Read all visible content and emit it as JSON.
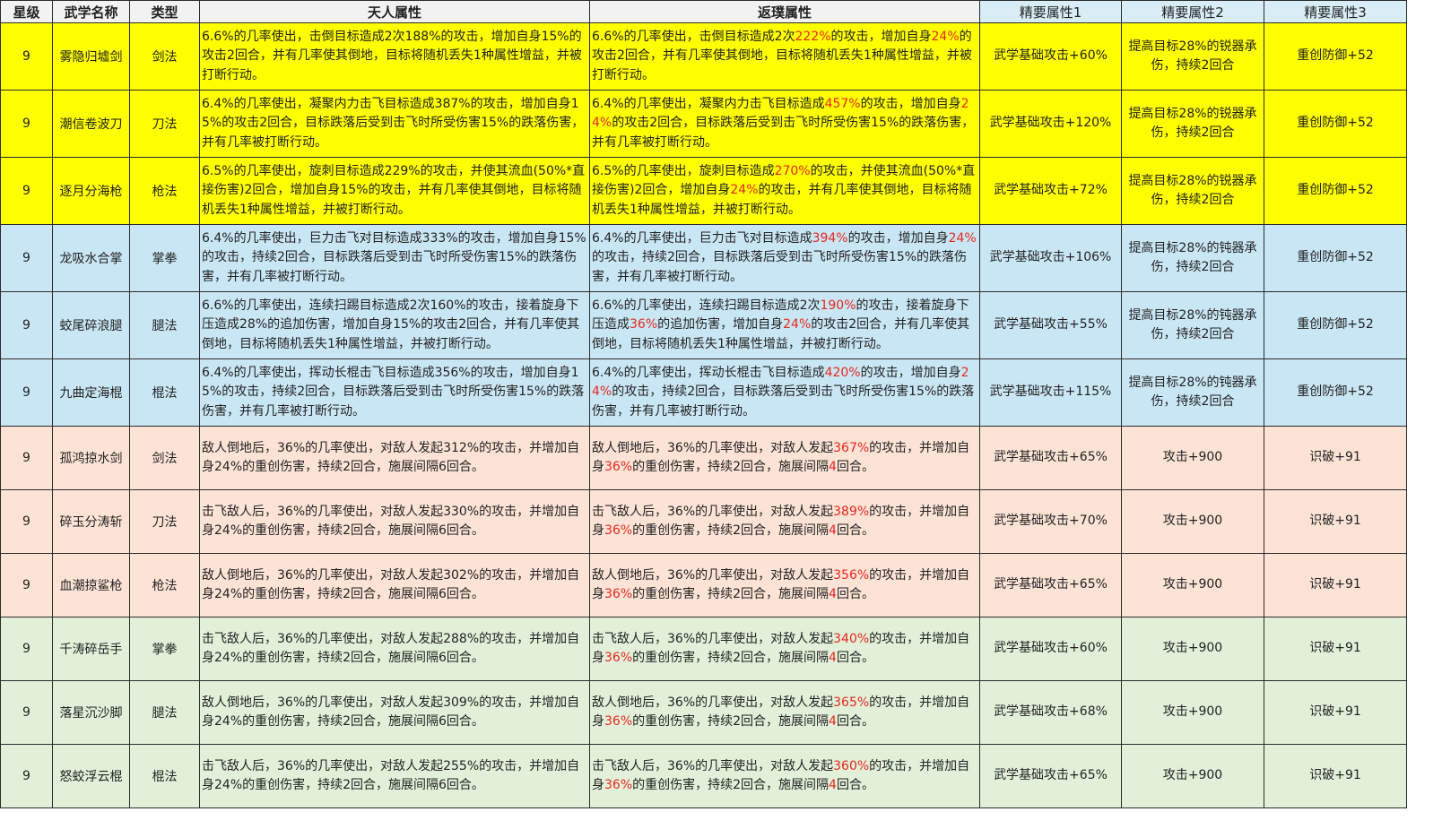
{
  "headers": {
    "star": "星级",
    "name": "武学名称",
    "type": "类型",
    "tianren": "天人属性",
    "fanpu": "返璞属性",
    "jy1": "精要属性1",
    "jy2": "精要属性2",
    "jy3": "精要属性3"
  },
  "colors": {
    "yellow": "#ffff00",
    "blue": "#c9e6f4",
    "peach": "#fce3d6",
    "green": "#e2f0d9",
    "highlight_red": "#e6281e"
  },
  "rows": [
    {
      "group": "y",
      "star": "9",
      "name": "雾隐归墟剑",
      "type": "剑法",
      "tianren": "6.6%的几率使出，击倒目标造成2次188%的攻击，增加自身15%的攻击2回合，并有几率使其倒地，目标将随机丢失1种属性增益，并被打断行动。",
      "fanpu": [
        {
          "t": "6.6%的几率使出，击倒目标造成2次"
        },
        {
          "t": "222%",
          "r": true
        },
        {
          "t": "的攻击，增加自身"
        },
        {
          "t": "24%",
          "r": true
        },
        {
          "t": "的攻击2回合，并有几率使其倒地，目标将随机丢失1种属性增益，并被打断行动。"
        }
      ],
      "jy1": "武学基础攻击+60%",
      "jy2": "提高目标28%的锐器承伤，持续2回合",
      "jy3": "重创防御+52"
    },
    {
      "group": "y",
      "star": "9",
      "name": "潮信卷波刀",
      "type": "刀法",
      "tianren": "6.4%的几率使出，凝聚内力击飞目标造成387%的攻击，增加自身15%的攻击2回合，目标跌落后受到击飞时所受伤害15%的跌落伤害，并有几率被打断行动。",
      "fanpu": [
        {
          "t": "6.4%的几率使出，凝聚内力击飞目标造成"
        },
        {
          "t": "457%",
          "r": true
        },
        {
          "t": "的攻击，增加自身"
        },
        {
          "t": "24%",
          "r": true
        },
        {
          "t": "的攻击2回合，目标跌落后受到击飞时所受伤害15%的跌落伤害，并有几率被打断行动。"
        }
      ],
      "jy1": "武学基础攻击+120%",
      "jy2": "提高目标28%的锐器承伤，持续2回合",
      "jy3": "重创防御+52"
    },
    {
      "group": "y",
      "star": "9",
      "name": "逐月分海枪",
      "type": "枪法",
      "tianren": "6.5%的几率使出，旋刺目标造成229%的攻击，并使其流血(50%*直接伤害)2回合，增加自身15%的攻击，并有几率使其倒地，目标将随机丢失1种属性增益，并被打断行动。",
      "fanpu": [
        {
          "t": "6.5%的几率使出，旋刺目标造成"
        },
        {
          "t": "270%",
          "r": true
        },
        {
          "t": "的攻击，并使其流血(50%*直接伤害)2回合，增加自身"
        },
        {
          "t": "24%",
          "r": true
        },
        {
          "t": "的攻击，并有几率使其倒地，目标将随机丢失1种属性增益，并被打断行动。"
        }
      ],
      "jy1": "武学基础攻击+72%",
      "jy2": "提高目标28%的锐器承伤，持续2回合",
      "jy3": "重创防御+52"
    },
    {
      "group": "b",
      "star": "9",
      "name": "龙吸水合掌",
      "type": "掌拳",
      "tianren": "6.4%的几率使出，巨力击飞对目标造成333%的攻击，增加自身15%的攻击，持续2回合，目标跌落后受到击飞时所受伤害15%的跌落伤害，并有几率被打断行动。",
      "fanpu": [
        {
          "t": "6.4%的几率使出，巨力击飞对目标造成"
        },
        {
          "t": "394%",
          "r": true
        },
        {
          "t": "的攻击，增加自身"
        },
        {
          "t": "24%",
          "r": true
        },
        {
          "t": "的攻击，持续2回合，目标跌落后受到击飞时所受伤害15%的跌落伤害，并有几率被打断行动。"
        }
      ],
      "jy1": "武学基础攻击+106%",
      "jy2": "提高目标28%的钝器承伤，持续2回合",
      "jy3": "重创防御+52"
    },
    {
      "group": "b",
      "star": "9",
      "name": "蛟尾碎浪腿",
      "type": "腿法",
      "tianren": "6.6%的几率使出，连续扫踢目标造成2次160%的攻击，接着旋身下压造成28%的追加伤害，增加自身15%的攻击2回合，并有几率使其倒地，目标将随机丢失1种属性增益，并被打断行动。",
      "fanpu": [
        {
          "t": "6.6%的几率使出，连续扫踢目标造成2次"
        },
        {
          "t": "190%",
          "r": true
        },
        {
          "t": "的攻击，接着旋身下压造成"
        },
        {
          "t": "36%",
          "r": true
        },
        {
          "t": "的追加伤害，增加自身"
        },
        {
          "t": "24%",
          "r": true
        },
        {
          "t": "的攻击2回合，并有几率使其倒地，目标将随机丢失1种属性增益，并被打断行动。"
        }
      ],
      "jy1": "武学基础攻击+55%",
      "jy2": "提高目标28%的钝器承伤，持续2回合",
      "jy3": "重创防御+52"
    },
    {
      "group": "b",
      "star": "9",
      "name": "九曲定海棍",
      "type": "棍法",
      "tianren": "6.4%的几率使出，挥动长棍击飞目标造成356%的攻击，增加自身15%的攻击，持续2回合，目标跌落后受到击飞时所受伤害15%的跌落伤害，并有几率被打断行动。",
      "fanpu": [
        {
          "t": "6.4%的几率使出，挥动长棍击飞目标造成"
        },
        {
          "t": "420%",
          "r": true
        },
        {
          "t": "的攻击，增加自身"
        },
        {
          "t": "24%",
          "r": true
        },
        {
          "t": "的攻击，持续2回合，目标跌落后受到击飞时所受伤害15%的跌落伤害，并有几率被打断行动。"
        }
      ],
      "jy1": "武学基础攻击+115%",
      "jy2": "提高目标28%的钝器承伤，持续2回合",
      "jy3": "重创防御+52"
    },
    {
      "group": "p",
      "star": "9",
      "name": "孤鸿掠水剑",
      "type": "剑法",
      "tianren": "敌人倒地后，36%的几率使出，对敌人发起312%的攻击，并增加自身24%的重创伤害，持续2回合，施展间隔6回合。",
      "fanpu": [
        {
          "t": "敌人倒地后，36%的几率使出，对敌人发起"
        },
        {
          "t": "367%",
          "r": true
        },
        {
          "t": "的攻击，并增加自身"
        },
        {
          "t": "36%",
          "r": true
        },
        {
          "t": "的重创伤害，持续2回合，施展间隔"
        },
        {
          "t": "4",
          "r": true
        },
        {
          "t": "回合。"
        }
      ],
      "jy1": "武学基础攻击+65%",
      "jy2": "攻击+900",
      "jy3": "识破+91"
    },
    {
      "group": "p",
      "star": "9",
      "name": "碎玉分涛斩",
      "type": "刀法",
      "tianren": "击飞敌人后，36%的几率使出，对敌人发起330%的攻击，并增加自身24%的重创伤害，持续2回合，施展间隔6回合。",
      "fanpu": [
        {
          "t": "击飞敌人后，36%的几率使出，对敌人发起"
        },
        {
          "t": "389%",
          "r": true
        },
        {
          "t": "的攻击，并增加自身"
        },
        {
          "t": "36%",
          "r": true
        },
        {
          "t": "的重创伤害，持续2回合，施展间隔"
        },
        {
          "t": "4",
          "r": true
        },
        {
          "t": "回合。"
        }
      ],
      "jy1": "武学基础攻击+70%",
      "jy2": "攻击+900",
      "jy3": "识破+91"
    },
    {
      "group": "p",
      "star": "9",
      "name": "血潮掠鲨枪",
      "type": "枪法",
      "tianren": "敌人倒地后，36%的几率使出，对敌人发起302%的攻击，并增加自身24%的重创伤害，持续2回合，施展间隔6回合。",
      "fanpu": [
        {
          "t": "敌人倒地后，36%的几率使出，对敌人发起"
        },
        {
          "t": "356%",
          "r": true
        },
        {
          "t": "的攻击，并增加自身"
        },
        {
          "t": "36%",
          "r": true
        },
        {
          "t": "的重创伤害，持续2回合，施展间隔"
        },
        {
          "t": "4",
          "r": true
        },
        {
          "t": "回合。"
        }
      ],
      "jy1": "武学基础攻击+65%",
      "jy2": "攻击+900",
      "jy3": "识破+91"
    },
    {
      "group": "g",
      "star": "9",
      "name": "千涛碎岳手",
      "type": "掌拳",
      "tianren": "击飞敌人后，36%的几率使出，对敌人发起288%的攻击，并增加自身24%的重创伤害，持续2回合，施展间隔6回合。",
      "fanpu": [
        {
          "t": "击飞敌人后，36%的几率使出，对敌人发起"
        },
        {
          "t": "340%",
          "r": true
        },
        {
          "t": "的攻击，并增加自身"
        },
        {
          "t": "36%",
          "r": true
        },
        {
          "t": "的重创伤害，持续2回合，施展间隔"
        },
        {
          "t": "4",
          "r": true
        },
        {
          "t": "回合。"
        }
      ],
      "jy1": "武学基础攻击+60%",
      "jy2": "攻击+900",
      "jy3": "识破+91"
    },
    {
      "group": "g",
      "star": "9",
      "name": "落星沉沙脚",
      "type": "腿法",
      "tianren": "敌人倒地后，36%的几率使出，对敌人发起309%的攻击，并增加自身24%的重创伤害，持续2回合，施展间隔6回合。",
      "fanpu": [
        {
          "t": "敌人倒地后，36%的几率使出，对敌人发起"
        },
        {
          "t": "365%",
          "r": true
        },
        {
          "t": "的攻击，并增加自身"
        },
        {
          "t": "36%",
          "r": true
        },
        {
          "t": "的重创伤害，持续2回合，施展间隔"
        },
        {
          "t": "4",
          "r": true
        },
        {
          "t": "回合。"
        }
      ],
      "jy1": "武学基础攻击+68%",
      "jy2": "攻击+900",
      "jy3": "识破+91"
    },
    {
      "group": "g",
      "star": "9",
      "name": "怒蛟浮云棍",
      "type": "棍法",
      "tianren": "击飞敌人后，36%的几率使出，对敌人发起255%的攻击，并增加自身24%的重创伤害，持续2回合，施展间隔6回合。",
      "fanpu": [
        {
          "t": "击飞敌人后，36%的几率使出，对敌人发起"
        },
        {
          "t": "360%",
          "r": true
        },
        {
          "t": "的攻击，并增加自身"
        },
        {
          "t": "36%",
          "r": true
        },
        {
          "t": "的重创伤害，持续2回合，施展间隔"
        },
        {
          "t": "4",
          "r": true
        },
        {
          "t": "回合。"
        }
      ],
      "jy1": "武学基础攻击+65%",
      "jy2": "攻击+900",
      "jy3": "识破+91"
    }
  ]
}
